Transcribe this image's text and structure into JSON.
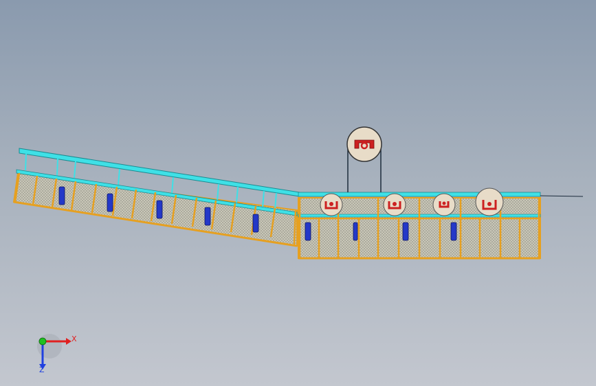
{
  "triad": {
    "x_label": "X",
    "z_label": "Z"
  },
  "colors": {
    "frame": "#e6a020",
    "frame_dark": "#8a5a10",
    "rail": "#3fe0e6",
    "mesh": "#b8b8a8",
    "cylinder": "#2438c8",
    "roller": "#e8dcc8",
    "bracket": "#cc2020",
    "x_axis": "#e02020",
    "y_axis": "#20c020",
    "z_axis": "#2040e0"
  }
}
